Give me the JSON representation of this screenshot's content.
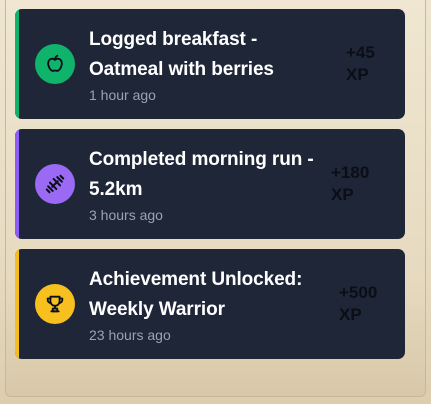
{
  "activities": [
    {
      "title": "Logged breakfast - Oatmeal with berries",
      "time": "1 hour ago",
      "xp_amount": "+45",
      "xp_unit": "XP",
      "icon": "apple-icon",
      "accent_color": "#10b36b",
      "icon_bg": "#10b36b"
    },
    {
      "title": "Completed morning run - 5.2km",
      "time": "3 hours ago",
      "xp_amount": "+180",
      "xp_unit": "XP",
      "icon": "dumbbell-icon",
      "accent_color": "#8b5cf6",
      "icon_bg": "#9b6af5"
    },
    {
      "title": "Achievement Unlocked: Weekly Warrior",
      "time": "23 hours ago",
      "xp_amount": "+500",
      "xp_unit": "XP",
      "icon": "trophy-icon",
      "accent_color": "#f6bd1e",
      "icon_bg": "#f8c01f"
    }
  ]
}
